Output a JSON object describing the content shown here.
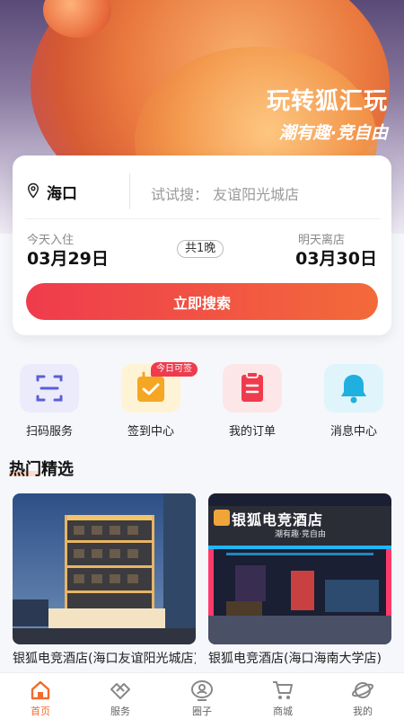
{
  "banner": {
    "headline": "玩转狐汇玩",
    "slogan": "潮有趣·竞自由"
  },
  "search": {
    "city": "海口",
    "hint": "试试搜：  友谊阳光城店",
    "checkin_label": "今天入住",
    "checkin_date": "03月29日",
    "nights": "共1晚",
    "checkout_label": "明天离店",
    "checkout_date": "03月30日",
    "button": "立即搜索"
  },
  "quick_actions": [
    {
      "label": "扫码服务",
      "icon": "scan-icon",
      "bg": "#ecebfb",
      "color": "#5b5fd6"
    },
    {
      "label": "签到中心",
      "icon": "calendar-check-icon",
      "bg": "#fff3d6",
      "color": "#f5a623",
      "badge": "今日可签"
    },
    {
      "label": "我的订单",
      "icon": "clipboard-icon",
      "bg": "#fde6e8",
      "color": "#ef3b4d"
    },
    {
      "label": "消息中心",
      "icon": "bell-icon",
      "bg": "#e0f5fb",
      "color": "#1fb0e0"
    }
  ],
  "hot": {
    "title": "热门精选",
    "hotels": [
      {
        "name": "银狐电竞酒店(海口友谊阳光城店)"
      },
      {
        "name": "银狐电竞酒店(海口海南大学店)",
        "sign": "银狐电竞酒店",
        "sign_sub": "潮有趣·竞自由"
      }
    ]
  },
  "tabbar": {
    "items": [
      {
        "label": "首页",
        "icon": "home-icon",
        "active": true
      },
      {
        "label": "服务",
        "icon": "service-icon"
      },
      {
        "label": "圈子",
        "icon": "circle-icon"
      },
      {
        "label": "商城",
        "icon": "cart-icon"
      },
      {
        "label": "我的",
        "icon": "profile-icon"
      }
    ]
  },
  "colors": {
    "accent": "#f26b2e",
    "primary_gradient_start": "#ef3b4d",
    "primary_gradient_end": "#f36a3a"
  }
}
